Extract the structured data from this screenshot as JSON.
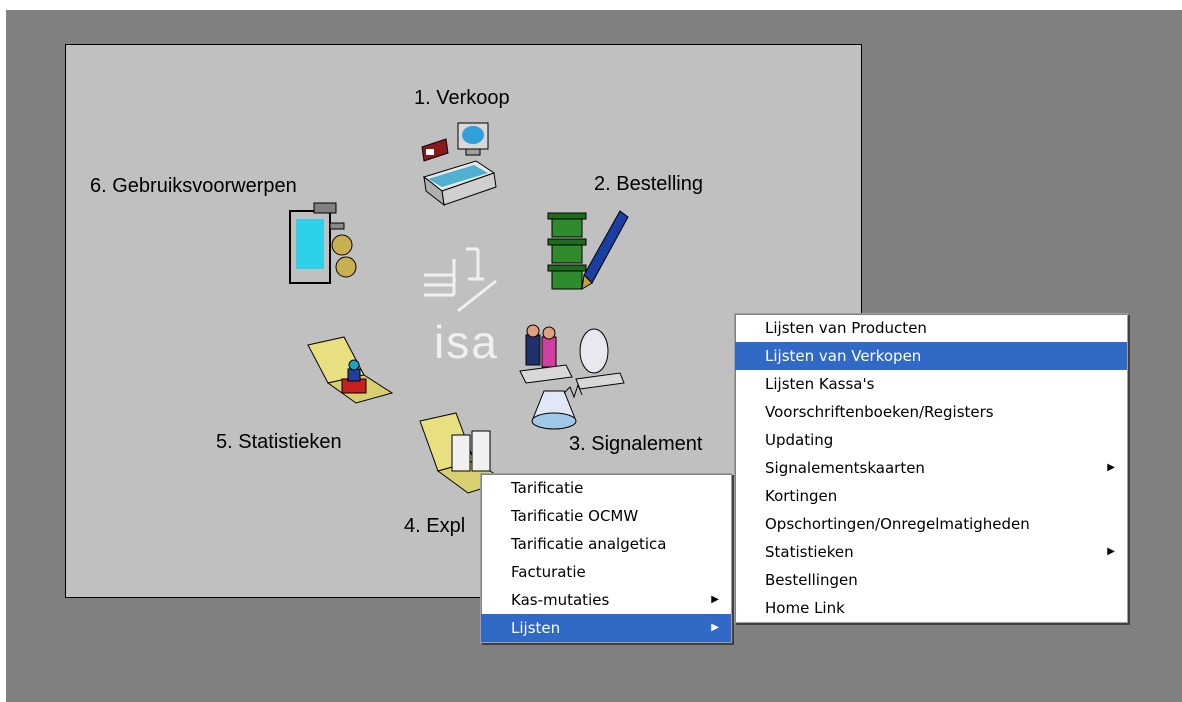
{
  "modules": {
    "m1": "1. Verkoop",
    "m2": "2. Bestelling",
    "m3": "3. Signalement",
    "m4": "4. Expl",
    "m5": "5. Statistieken",
    "m6": "6. Gebruiksvoorwerpen"
  },
  "logo_text": "isa",
  "menu_main": {
    "items": [
      {
        "label": "Tarificatie"
      },
      {
        "label": "Tarificatie OCMW"
      },
      {
        "label": "Tarificatie analgetica"
      },
      {
        "label": "Facturatie"
      },
      {
        "label": "Kas-mutaties",
        "submenu": true
      },
      {
        "label": "Lijsten",
        "submenu": true,
        "selected": true
      }
    ]
  },
  "menu_sub": {
    "items": [
      {
        "label": "Lijsten van Producten"
      },
      {
        "label": "Lijsten van Verkopen",
        "selected": true
      },
      {
        "label": "Lijsten Kassa's"
      },
      {
        "label": "Voorschriftenboeken/Registers"
      },
      {
        "label": "Updating"
      },
      {
        "label": "Signalementskaarten",
        "submenu": true
      },
      {
        "label": "Kortingen"
      },
      {
        "label": "Opschortingen/Onregelmatigheden"
      },
      {
        "label": "Statistieken",
        "submenu": true
      },
      {
        "label": "Bestellingen"
      },
      {
        "label": "Home Link"
      }
    ]
  },
  "icons": {
    "submenu_arrow": "▶"
  },
  "colors": {
    "highlight": "#3169c6",
    "desktop": "#808080",
    "panel": "#c0c0c0"
  }
}
